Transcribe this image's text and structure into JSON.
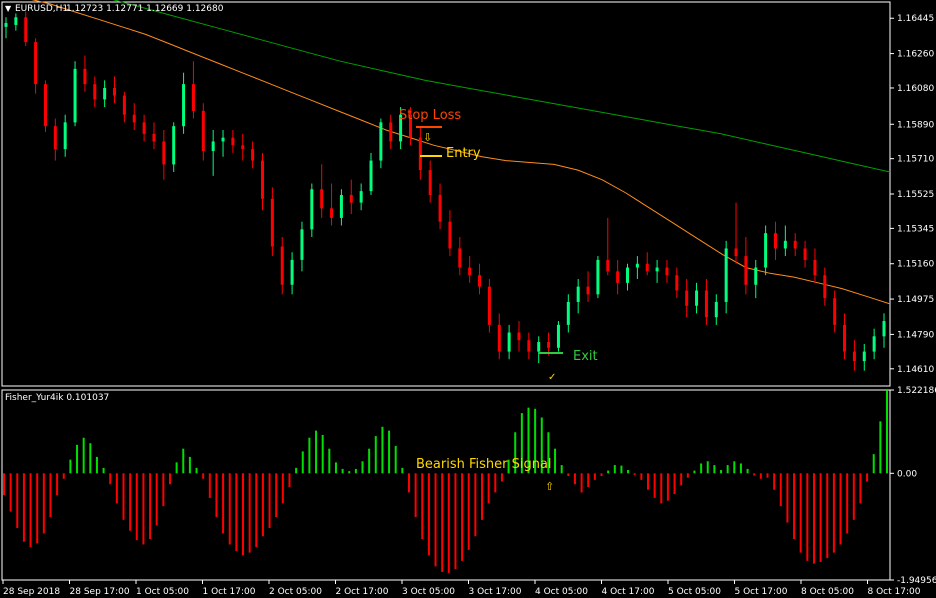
{
  "main_chart": {
    "symbol_label": "EURUSD,H1",
    "ohlc_label": "1.12723 1.12771 1.12669 1.12680",
    "price_ticks": [
      "1.16445",
      "1.16260",
      "1.16080",
      "1.15890",
      "1.15710",
      "1.15525",
      "1.15345",
      "1.15160",
      "1.14975",
      "1.14790",
      "1.14610"
    ],
    "annotations": {
      "stop_loss": "Stop Loss",
      "entry": "Entry",
      "exit": "Exit",
      "arrow_down": "⇩",
      "check": "✓"
    }
  },
  "indicator": {
    "label": "Fisher_Yur4ik 0.101037",
    "signal_text": "Bearish Fisher Signal",
    "arrow_up": "⇧",
    "scale_ticks": [
      "1.522186",
      "0.00",
      "-1.949569"
    ]
  },
  "time_axis": [
    "28 Sep 2018",
    "28 Sep 17:00",
    "1 Oct 05:00",
    "1 Oct 17:00",
    "2 Oct 05:00",
    "2 Oct 17:00",
    "3 Oct 05:00",
    "3 Oct 17:00",
    "4 Oct 05:00",
    "4 Oct 17:00",
    "5 Oct 05:00",
    "5 Oct 17:00",
    "8 Oct 05:00",
    "8 Oct 17:00"
  ],
  "colors": {
    "background": "#000000",
    "bull": "#00ff7f",
    "bear": "#ff0000",
    "fisher_pos": "#00e000",
    "fisher_neg": "#ff0000",
    "ma_fast": "#ff8c1a",
    "ma_slow": "#00a000",
    "stop_loss": "#ff4500",
    "entry": "#ffd700",
    "exit": "#2ecc40",
    "signal": "#ffd700",
    "axis": "#ffffff"
  },
  "chart_data": [
    {
      "type": "candlestick",
      "title": "EURUSD,H1",
      "ylim": [
        1.1452,
        1.1653
      ],
      "series": [
        {
          "name": "candles",
          "ohlc": [
            [
              1.164,
              1.1645,
              1.1634,
              1.1642
            ],
            [
              1.1641,
              1.1647,
              1.1638,
              1.1645
            ],
            [
              1.1645,
              1.1648,
              1.163,
              1.1632
            ],
            [
              1.1632,
              1.1634,
              1.1605,
              1.161
            ],
            [
              1.161,
              1.1612,
              1.1585,
              1.1588
            ],
            [
              1.1588,
              1.1592,
              1.157,
              1.1576
            ],
            [
              1.1576,
              1.1594,
              1.1572,
              1.159
            ],
            [
              1.159,
              1.1622,
              1.1588,
              1.1618
            ],
            [
              1.1618,
              1.1625,
              1.1606,
              1.161
            ],
            [
              1.161,
              1.1614,
              1.1598,
              1.1602
            ],
            [
              1.1602,
              1.1612,
              1.1598,
              1.1608
            ],
            [
              1.1608,
              1.1614,
              1.16,
              1.1604
            ],
            [
              1.1604,
              1.1606,
              1.159,
              1.1594
            ],
            [
              1.1594,
              1.16,
              1.1586,
              1.159
            ],
            [
              1.159,
              1.1594,
              1.158,
              1.1584
            ],
            [
              1.1584,
              1.159,
              1.1576,
              1.158
            ],
            [
              1.158,
              1.1586,
              1.156,
              1.1568
            ],
            [
              1.1568,
              1.159,
              1.1564,
              1.1588
            ],
            [
              1.1588,
              1.1616,
              1.1584,
              1.161
            ],
            [
              1.161,
              1.1622,
              1.1592,
              1.1596
            ],
            [
              1.1596,
              1.16,
              1.157,
              1.1575
            ],
            [
              1.1575,
              1.1586,
              1.1562,
              1.158
            ],
            [
              1.158,
              1.1586,
              1.1572,
              1.1582
            ],
            [
              1.1582,
              1.1586,
              1.1574,
              1.1578
            ],
            [
              1.1578,
              1.1584,
              1.157,
              1.1576
            ],
            [
              1.1576,
              1.158,
              1.1566,
              1.157
            ],
            [
              1.157,
              1.1574,
              1.1544,
              1.155
            ],
            [
              1.155,
              1.1556,
              1.152,
              1.1525
            ],
            [
              1.1525,
              1.153,
              1.15,
              1.1505
            ],
            [
              1.1505,
              1.1522,
              1.15,
              1.1518
            ],
            [
              1.1518,
              1.1538,
              1.1512,
              1.1534
            ],
            [
              1.1534,
              1.1558,
              1.153,
              1.1555
            ],
            [
              1.1555,
              1.1568,
              1.154,
              1.1545
            ],
            [
              1.1545,
              1.1558,
              1.1536,
              1.154
            ],
            [
              1.154,
              1.1555,
              1.1536,
              1.1552
            ],
            [
              1.1552,
              1.156,
              1.1542,
              1.1548
            ],
            [
              1.1548,
              1.1558,
              1.1544,
              1.1554
            ],
            [
              1.1554,
              1.1574,
              1.1552,
              1.157
            ],
            [
              1.157,
              1.1592,
              1.1566,
              1.159
            ],
            [
              1.159,
              1.1594,
              1.1576,
              1.158
            ],
            [
              1.158,
              1.1598,
              1.1576,
              1.1594
            ],
            [
              1.1594,
              1.1598,
              1.1578,
              1.1582
            ],
            [
              1.1582,
              1.1588,
              1.156,
              1.1565
            ],
            [
              1.1565,
              1.157,
              1.1548,
              1.1552
            ],
            [
              1.1552,
              1.1558,
              1.1534,
              1.1538
            ],
            [
              1.1538,
              1.1544,
              1.152,
              1.1524
            ],
            [
              1.1524,
              1.153,
              1.151,
              1.1514
            ],
            [
              1.1514,
              1.152,
              1.1506,
              1.151
            ],
            [
              1.151,
              1.1516,
              1.15,
              1.1504
            ],
            [
              1.1504,
              1.1508,
              1.148,
              1.1484
            ],
            [
              1.1484,
              1.149,
              1.1466,
              1.147
            ],
            [
              1.147,
              1.1484,
              1.1466,
              1.148
            ],
            [
              1.148,
              1.1486,
              1.147,
              1.1476
            ],
            [
              1.1476,
              1.148,
              1.1466,
              1.147
            ],
            [
              1.147,
              1.1478,
              1.1464,
              1.1475
            ],
            [
              1.1475,
              1.148,
              1.1468,
              1.1472
            ],
            [
              1.1472,
              1.1486,
              1.147,
              1.1484
            ],
            [
              1.1484,
              1.15,
              1.148,
              1.1496
            ],
            [
              1.1496,
              1.1508,
              1.149,
              1.1504
            ],
            [
              1.1504,
              1.1512,
              1.1496,
              1.15
            ],
            [
              1.15,
              1.152,
              1.1498,
              1.1518
            ],
            [
              1.1518,
              1.154,
              1.151,
              1.1512
            ],
            [
              1.1512,
              1.1518,
              1.15,
              1.1506
            ],
            [
              1.1506,
              1.1516,
              1.1502,
              1.1514
            ],
            [
              1.1514,
              1.152,
              1.1508,
              1.1516
            ],
            [
              1.1516,
              1.1522,
              1.151,
              1.1512
            ],
            [
              1.1512,
              1.1518,
              1.1506,
              1.1514
            ],
            [
              1.1514,
              1.1518,
              1.1506,
              1.151
            ],
            [
              1.151,
              1.1514,
              1.1498,
              1.1502
            ],
            [
              1.1502,
              1.1508,
              1.1488,
              1.1494
            ],
            [
              1.1494,
              1.1506,
              1.149,
              1.1502
            ],
            [
              1.1502,
              1.1508,
              1.1484,
              1.1488
            ],
            [
              1.1488,
              1.15,
              1.1484,
              1.1496
            ],
            [
              1.1496,
              1.1528,
              1.149,
              1.1524
            ],
            [
              1.1524,
              1.1548,
              1.1516,
              1.152
            ],
            [
              1.152,
              1.153,
              1.15,
              1.1505
            ],
            [
              1.1505,
              1.1518,
              1.1498,
              1.1514
            ],
            [
              1.1514,
              1.1536,
              1.151,
              1.1532
            ],
            [
              1.1532,
              1.1538,
              1.1518,
              1.1524
            ],
            [
              1.1524,
              1.1536,
              1.152,
              1.1528
            ],
            [
              1.1528,
              1.1532,
              1.152,
              1.1524
            ],
            [
              1.1524,
              1.1528,
              1.1514,
              1.1518
            ],
            [
              1.1518,
              1.1524,
              1.1506,
              1.151
            ],
            [
              1.151,
              1.1514,
              1.1494,
              1.1498
            ],
            [
              1.1498,
              1.1502,
              1.148,
              1.1484
            ],
            [
              1.1484,
              1.149,
              1.1466,
              1.147
            ],
            [
              1.147,
              1.1476,
              1.146,
              1.1465
            ],
            [
              1.1465,
              1.1474,
              1.146,
              1.147
            ],
            [
              1.147,
              1.1482,
              1.1466,
              1.1478
            ],
            [
              1.1478,
              1.149,
              1.1472,
              1.1486
            ]
          ]
        },
        {
          "name": "ma_fast",
          "values": [
            1.1658,
            1.1655,
            1.1652,
            1.1648,
            1.1644,
            1.164,
            1.1636,
            1.1631,
            1.1626,
            1.1621,
            1.1616,
            1.1611,
            1.1606,
            1.1601,
            1.1596,
            1.1591,
            1.1586,
            1.1582,
            1.1578,
            1.1575,
            1.1572,
            1.157,
            1.1569,
            1.1568,
            1.1565,
            1.156,
            1.1553,
            1.1545,
            1.1537,
            1.1529,
            1.1521,
            1.1514,
            1.1511,
            1.1509,
            1.1506,
            1.1503,
            1.1499,
            1.1495
          ]
        },
        {
          "name": "ma_slow",
          "values": [
            1.167,
            1.1664,
            1.1658,
            1.1652,
            1.1646,
            1.164,
            1.1634,
            1.1628,
            1.1622,
            1.1617,
            1.1612,
            1.1608,
            1.1604,
            1.16,
            1.1596,
            1.1592,
            1.1588,
            1.1584,
            1.1579,
            1.1574,
            1.1569,
            1.1564
          ]
        }
      ]
    },
    {
      "type": "bar",
      "title": "Fisher_Yur4ik 0.101037",
      "ylim": [
        -1.949569,
        1.522186
      ],
      "series": [
        {
          "name": "fisher",
          "values": [
            -0.4,
            -0.7,
            -1.0,
            -1.25,
            -1.35,
            -1.28,
            -1.1,
            -0.8,
            -0.4,
            -0.1,
            0.25,
            0.52,
            0.65,
            0.55,
            0.3,
            0.1,
            -0.2,
            -0.55,
            -0.85,
            -1.05,
            -1.22,
            -1.3,
            -1.2,
            -0.95,
            -0.6,
            -0.2,
            0.2,
            0.45,
            0.3,
            0.1,
            -0.1,
            -0.45,
            -0.8,
            -1.1,
            -1.3,
            -1.42,
            -1.5,
            -1.45,
            -1.35,
            -1.15,
            -1.0,
            -0.8,
            -0.55,
            -0.25,
            0.1,
            0.4,
            0.65,
            0.78,
            0.7,
            0.45,
            0.2,
            0.08,
            0.04,
            0.08,
            0.22,
            0.45,
            0.68,
            0.85,
            0.78,
            0.5,
            0.1,
            -0.35,
            -0.8,
            -1.2,
            -1.5,
            -1.7,
            -1.8,
            -1.82,
            -1.75,
            -1.6,
            -1.4,
            -1.15,
            -0.85,
            -0.55,
            -0.35,
            -0.15,
            0.25,
            0.75,
            1.1,
            1.2,
            1.18,
            1.02,
            0.75,
            0.45,
            0.15,
            -0.05,
            -0.2,
            -0.35,
            -0.25,
            -0.12,
            -0.05,
            0.05,
            0.15,
            0.14,
            0.06,
            -0.03,
            -0.12,
            -0.3,
            -0.45,
            -0.55,
            -0.5,
            -0.38,
            -0.22,
            -0.08,
            0.05,
            0.18,
            0.22,
            0.15,
            0.06,
            0.15,
            0.22,
            0.18,
            0.08,
            -0.04,
            -0.1,
            -0.08,
            -0.3,
            -0.6,
            -0.9,
            -1.2,
            -1.45,
            -1.6,
            -1.65,
            -1.62,
            -1.55,
            -1.45,
            -1.3,
            -1.1,
            -0.85,
            -0.55,
            -0.15,
            0.35,
            0.95,
            1.52
          ]
        }
      ]
    }
  ]
}
